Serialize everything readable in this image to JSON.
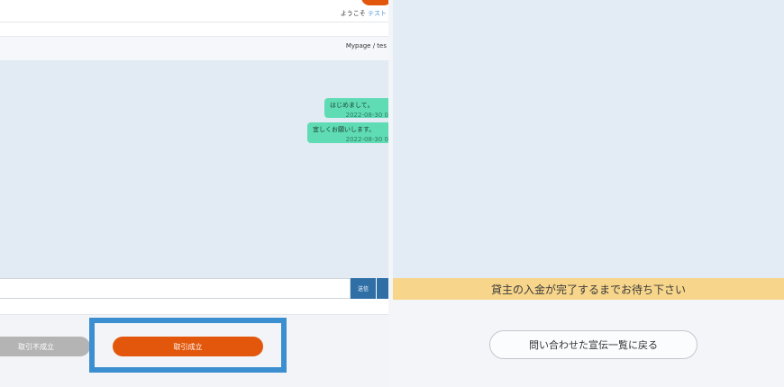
{
  "header": {
    "welcome_prefix": "ようこそ",
    "user_name": "テスト"
  },
  "breadcrumb": "Mypage / tes",
  "messages": [
    {
      "text": "はじめまして。",
      "time": "2022-08-30 0"
    },
    {
      "text": "宜しくお願いします。",
      "time": "2022-08-30 0"
    }
  ],
  "composer": {
    "send_label": "送信"
  },
  "actions": {
    "fail_label": "取引不成立",
    "success_label": "取引成立"
  },
  "right": {
    "notice": "貸主の入金が完了するまでお待ち下さい",
    "back_label": "問い合わせた宣伝一覧に戻る"
  },
  "colors": {
    "accent": "#e2570b",
    "highlight": "#3b8fd0",
    "bubble": "#5fdcb3",
    "notice": "#f7d58a"
  }
}
